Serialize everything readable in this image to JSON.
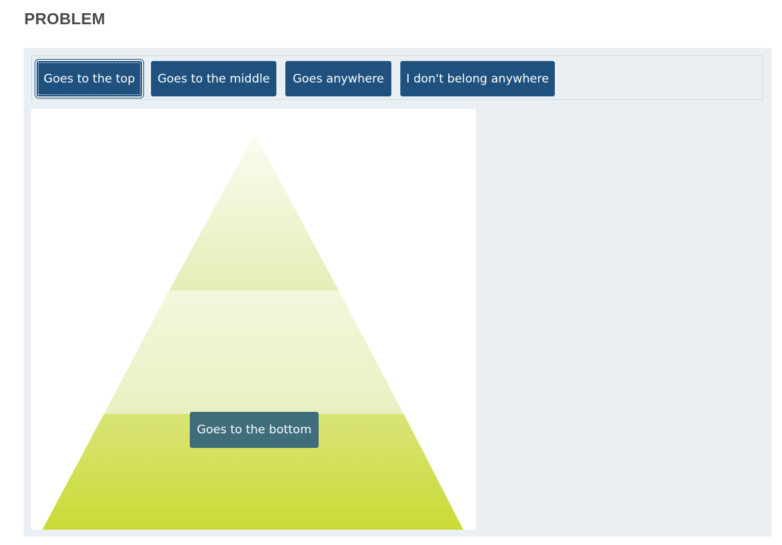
{
  "problem": {
    "title": "PROBLEM"
  },
  "draggable_bank": {
    "items": [
      {
        "label": "Goes to the top"
      },
      {
        "label": "Goes to the middle"
      },
      {
        "label": "Goes anywhere"
      },
      {
        "label": "I don't belong anywhere"
      }
    ]
  },
  "target": {
    "zones": [
      "top",
      "middle",
      "bottom"
    ],
    "placed_items": [
      {
        "label": "Goes to the bottom",
        "zone": "bottom"
      }
    ]
  },
  "colors": {
    "item_background": "#1f517e",
    "placed_item_background": "#3f6d7a",
    "panel_background": "#e9eff2",
    "pyramid_top": "#e6eeb8",
    "pyramid_middle": "#eaf1c4",
    "pyramid_bottom": "#cddc39"
  }
}
